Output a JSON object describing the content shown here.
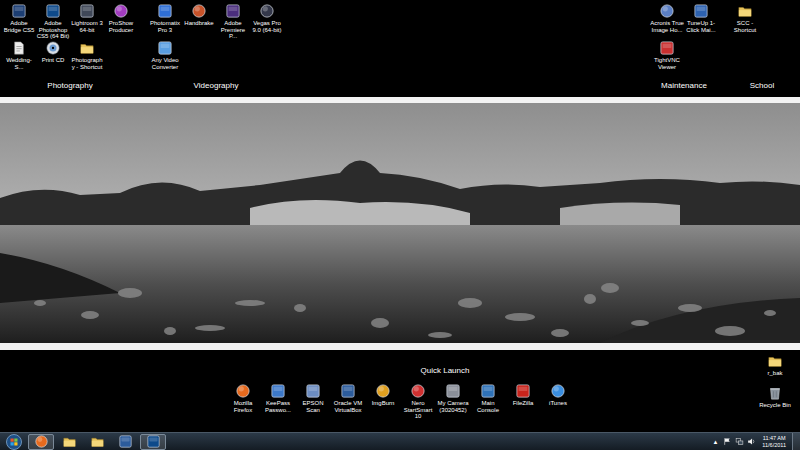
{
  "desktop": {
    "groups": [
      {
        "label": "Photography",
        "icons": [
          {
            "label": "Adobe Bridge CS5"
          },
          {
            "label": "Adobe Photoshop CS5 (64 Bit)"
          },
          {
            "label": "Lightroom 3 64-bit"
          },
          {
            "label": "ProShow Producer"
          },
          {
            "label": "Wedding-S..."
          },
          {
            "label": "Print CD"
          },
          {
            "label": "Photography - Shortcut"
          }
        ]
      },
      {
        "label": "Videography",
        "icons": [
          {
            "label": "Photomatix Pro 3"
          },
          {
            "label": "Handbrake"
          },
          {
            "label": "Adobe Premiere P..."
          },
          {
            "label": "Vegas Pro 9.0 (64-bit)"
          },
          {
            "label": "Any Video Converter"
          }
        ]
      },
      {
        "label": "Maintenance",
        "icons": [
          {
            "label": "Acronis True Image Ho..."
          },
          {
            "label": "TuneUp 1-Click Mai..."
          },
          {
            "label": "TightVNC Viewer"
          }
        ]
      },
      {
        "label": "School",
        "icons": [
          {
            "label": "SCC - Shortcut"
          }
        ]
      }
    ],
    "quick_launch": {
      "label": "Quick Launch",
      "icons": [
        {
          "label": "Mozilla Firefox"
        },
        {
          "label": "KeePass Passwo..."
        },
        {
          "label": "EPSON Scan"
        },
        {
          "label": "Oracle VM VirtualBox"
        },
        {
          "label": "ImgBurn"
        },
        {
          "label": "Nero StartSmart 10"
        },
        {
          "label": "My Camera (3020452)"
        },
        {
          "label": "Main Console"
        },
        {
          "label": "FileZilla"
        },
        {
          "label": "iTunes"
        }
      ]
    },
    "corner_icons": [
      {
        "label": "r_bak"
      },
      {
        "label": "Recycle Bin"
      }
    ]
  },
  "taskbar": {
    "apps": [
      {
        "running": true
      },
      {
        "running": false
      },
      {
        "running": false
      },
      {
        "running": false
      },
      {
        "running": true
      }
    ],
    "tray_toggle": "▲",
    "clock": {
      "time": "11:47 AM",
      "date": "11/6/2011"
    }
  }
}
